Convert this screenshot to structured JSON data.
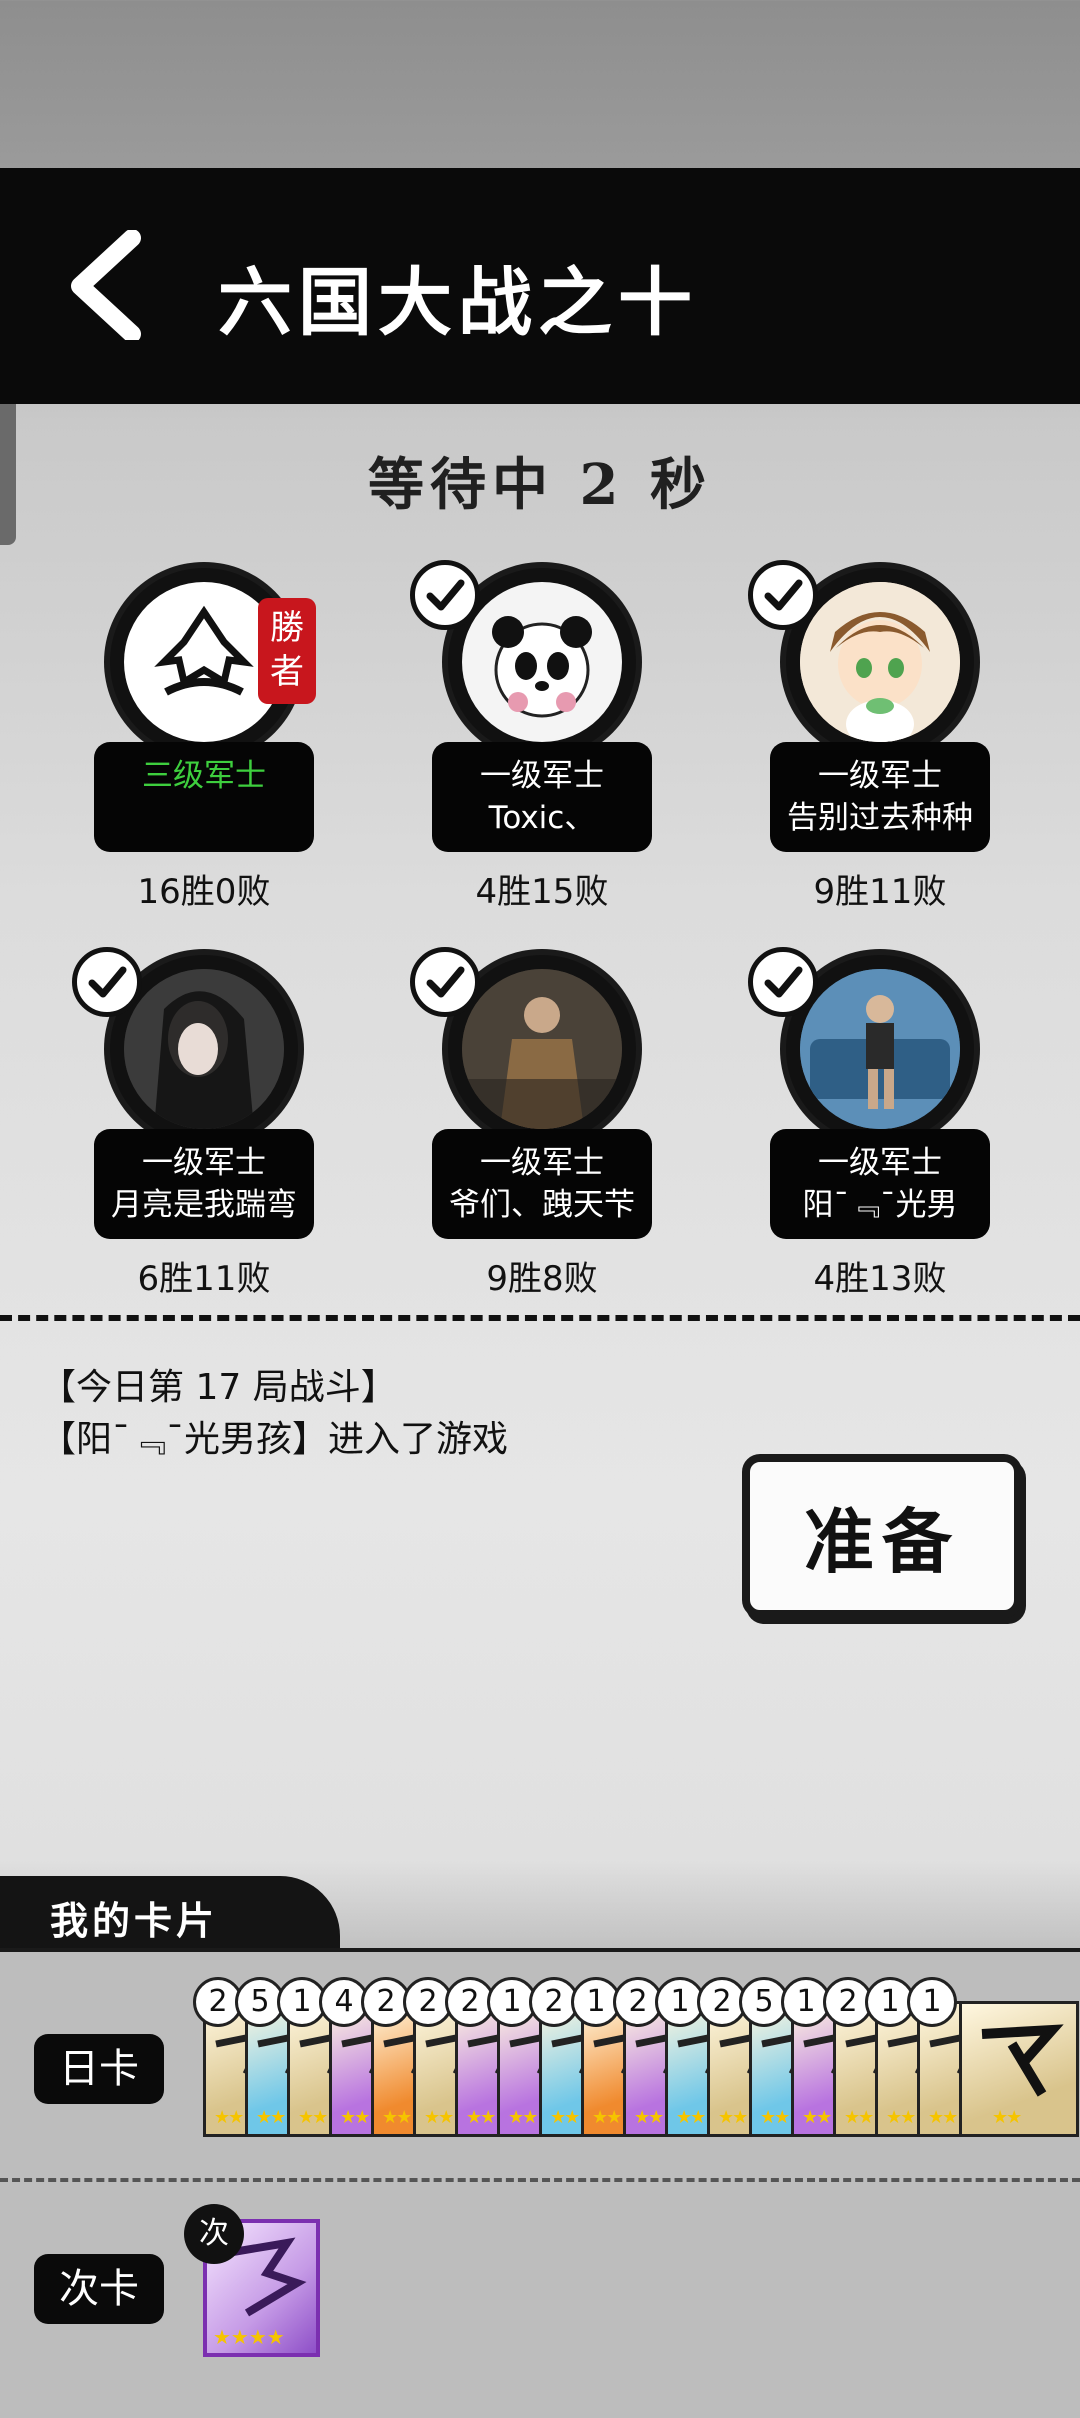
{
  "header": {
    "title": "六国大战之十"
  },
  "status": {
    "countdown": "等待中 2 秒"
  },
  "players": [
    {
      "rank": "三级军士",
      "rank_color": "#3ecf3e",
      "name": "",
      "record": "16胜0败",
      "ready": false,
      "winner": true,
      "winner_badge": "勝者"
    },
    {
      "rank": "一级军士",
      "rank_color": "#ffffff",
      "name": "Toxic、",
      "record": "4胜15败",
      "ready": true,
      "winner": false
    },
    {
      "rank": "一级军士",
      "rank_color": "#ffffff",
      "name": "告别过去种种",
      "record": "9胜11败",
      "ready": true,
      "winner": false
    },
    {
      "rank": "一级军士",
      "rank_color": "#ffffff",
      "name": "月亮是我踹弯",
      "record": "6胜11败",
      "ready": true,
      "winner": false
    },
    {
      "rank": "一级军士",
      "rank_color": "#ffffff",
      "name": "爷们、跩天芐",
      "record": "9胜8败",
      "ready": true,
      "winner": false
    },
    {
      "rank": "一级军士",
      "rank_color": "#ffffff",
      "name": "阳ˉ﹃ˉ光男",
      "record": "4胜13败",
      "ready": true,
      "winner": false
    }
  ],
  "log": [
    "【今日第 17 局战斗】",
    "【阳ˉ﹃ˉ光男孩】进入了游戏"
  ],
  "ready_button": {
    "label": "准备"
  },
  "my_cards": {
    "title": "我的卡片",
    "day_label": "日卡",
    "next_label": "次卡",
    "next_badge": "次",
    "day_counts": [
      "2",
      "5",
      "1",
      "4",
      "2",
      "2",
      "2",
      "1",
      "2",
      "1",
      "2",
      "1",
      "2",
      "5",
      "1",
      "2",
      "1",
      "1"
    ],
    "day_colors": [
      "#d9c48c",
      "#6fc7e8",
      "#d9c48c",
      "#b873e0",
      "#f08a2e",
      "#d9c48c",
      "#b873e0",
      "#b873e0",
      "#6fc7e8",
      "#f08a2e",
      "#b873e0",
      "#6fc7e8",
      "#d9c48c",
      "#6fc7e8",
      "#b873e0",
      "#d9c48c",
      "#d9c48c",
      "#d9c48c"
    ],
    "next_stars": "★★★★"
  }
}
